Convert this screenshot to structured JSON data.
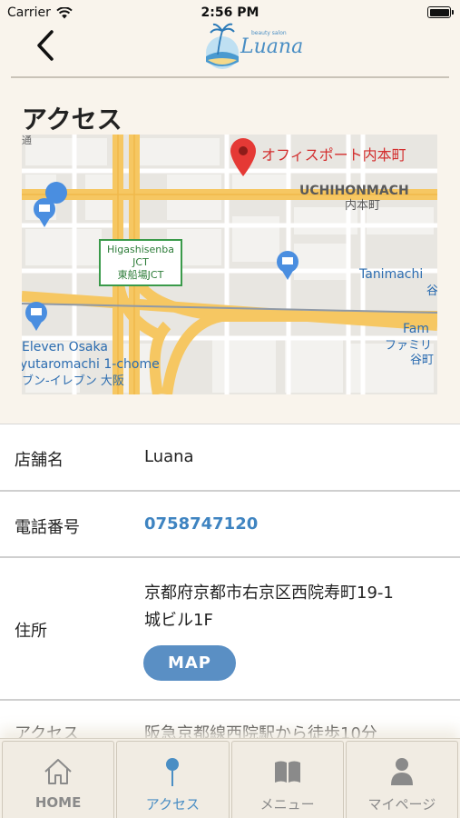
{
  "status_bar": {
    "carrier": "Carrier",
    "time": "2:56 PM"
  },
  "header": {
    "logo_text": "Luana",
    "logo_tagline": "beauty salon"
  },
  "section": {
    "title": "アクセス"
  },
  "map": {
    "labels": {
      "place": "オフィスポート内本町",
      "uchihonmachi_en": "UCHIHONMACH",
      "uchihonmachi_jp": "内本町",
      "jct_en_1": "Higashisenba",
      "jct_en_2": "JCT",
      "jct_jp": "東船場JCT",
      "tanimachi": "Tanimachi",
      "tanimachi_jp": "谷",
      "family_en": "Fam",
      "family_jp": "ファミリ",
      "seven_en_1": "Eleven Osaka",
      "seven_en_2": "yutaromachi 1-chome",
      "seven_jp": "ブン-イレブン 大阪",
      "edge_top": "通",
      "edge_right": "谷",
      "edge_right2": "谷町"
    }
  },
  "info": {
    "store_label": "店舗名",
    "store_value": "Luana",
    "phone_label": "電話番号",
    "phone_value": "0758747120",
    "address_label": "住所",
    "address_line1": "京都府京都市右京区西院寿町19-1",
    "address_line2": "城ビル1F",
    "map_button": "MAP",
    "access_label": "アクセス",
    "access_value": "阪急京都線西院駅から徒歩10分"
  },
  "tabs": [
    {
      "label": "HOME",
      "icon": "home-icon"
    },
    {
      "label": "アクセス",
      "icon": "map-pin-icon"
    },
    {
      "label": "メニュー",
      "icon": "book-icon"
    },
    {
      "label": "マイページ",
      "icon": "person-icon"
    }
  ],
  "colors": {
    "accent": "#4a8ec4",
    "background": "#f9f4ec",
    "button": "#5a8fc4"
  }
}
